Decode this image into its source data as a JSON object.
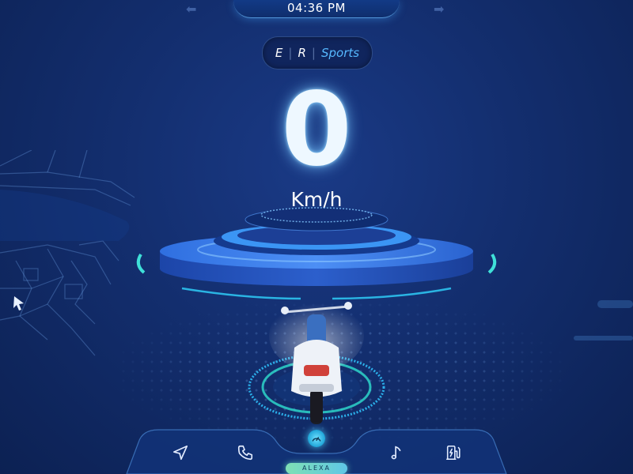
{
  "status_bar": {
    "time": "04:36 PM"
  },
  "drive_mode": {
    "options": [
      "E",
      "R",
      "Sports"
    ],
    "selected": "Sports"
  },
  "speedometer": {
    "value": "0",
    "unit": "Km/h"
  },
  "bottom_nav": {
    "items": [
      {
        "id": "navigation",
        "icon": "navigation-icon"
      },
      {
        "id": "phone",
        "icon": "phone-icon"
      },
      {
        "id": "dashboard",
        "icon": "speedometer-icon"
      },
      {
        "id": "music",
        "icon": "music-note-icon"
      },
      {
        "id": "charging",
        "icon": "charging-station-icon"
      }
    ],
    "assistant_label": "ALEXA"
  },
  "colors": {
    "accent": "#56b8ff",
    "glow": "#2fd6ff",
    "background": "#132e6e"
  }
}
